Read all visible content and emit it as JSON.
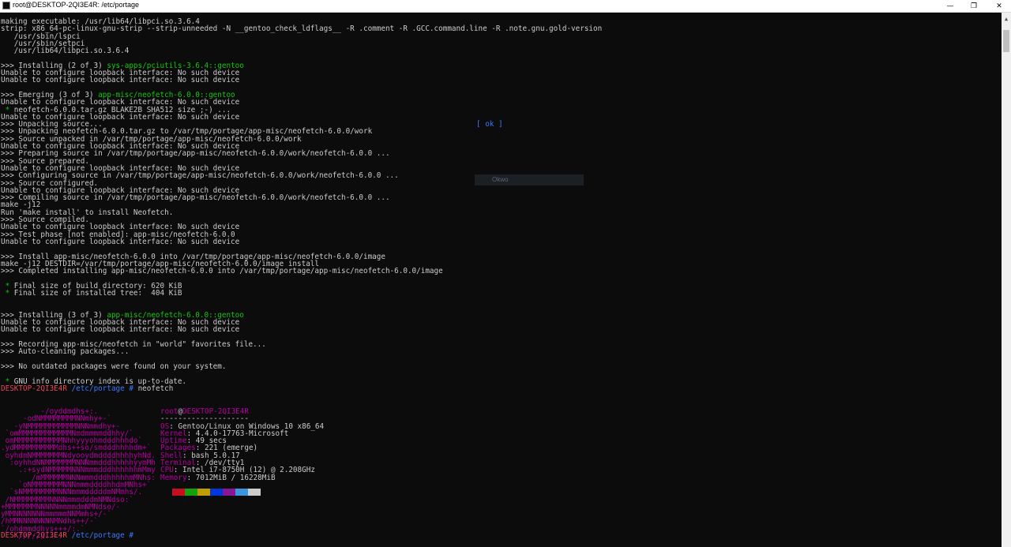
{
  "window": {
    "title": "root@DESKTOP-2QI3E4R: /etc/portage"
  },
  "controls": {
    "minimize": "—",
    "maximize": "❐",
    "close": "✕"
  },
  "build_log": [
    "making executable: /usr/lib64/libpci.so.3.6.4",
    "strip: x86_64-pc-linux-gnu-strip --strip-unneeded -N __gentoo_check_ldflags__ -R .comment -R .GCC.command.line -R .note.gnu.gold-version",
    "   /usr/sbin/lspci",
    "   /usr/sbin/setpci",
    "   /usr/lib64/libpci.so.3.6.4",
    "",
    ">>> Installing (2 of 3) |sys-apps/pciutils-3.6.4::gentoo",
    "Unable to configure loopback interface: No such device",
    "Unable to configure loopback interface: No such device",
    "",
    ">>> Emerging (3 of 3) |app-misc/neofetch-6.0.0::gentoo",
    "Unable to configure loopback interface: No such device",
    " * neofetch-6.0.0.tar.gz BLAKE2B SHA512 size ;-) ...",
    "Unable to configure loopback interface: No such device",
    ">>> Unpacking source...",
    ">>> Unpacking neofetch-6.0.0.tar.gz to /var/tmp/portage/app-misc/neofetch-6.0.0/work",
    ">>> Source unpacked in /var/tmp/portage/app-misc/neofetch-6.0.0/work",
    "Unable to configure loopback interface: No such device",
    ">>> Preparing source in /var/tmp/portage/app-misc/neofetch-6.0.0/work/neofetch-6.0.0 ...",
    ">>> Source prepared.",
    "Unable to configure loopback interface: No such device",
    ">>> Configuring source in /var/tmp/portage/app-misc/neofetch-6.0.0/work/neofetch-6.0.0 ...",
    ">>> Source configured.",
    "Unable to configure loopback interface: No such device",
    ">>> Compiling source in /var/tmp/portage/app-misc/neofetch-6.0.0/work/neofetch-6.0.0 ...",
    "make -j12",
    "Run 'make install' to install Neofetch.",
    ">>> Source compiled.",
    "Unable to configure loopback interface: No such device",
    ">>> Test phase [not enabled]: app-misc/neofetch-6.0.0",
    "Unable to configure loopback interface: No such device",
    "",
    ">>> Install app-misc/neofetch-6.0.0 into /var/tmp/portage/app-misc/neofetch-6.0.0/image",
    "make -j12 DESTDIR=/var/tmp/portage/app-misc/neofetch-6.0.0/image install",
    ">>> Completed installing app-misc/neofetch-6.0.0 into /var/tmp/portage/app-misc/neofetch-6.0.0/image",
    "",
    " * Final size of build directory: 620 KiB",
    " * Final size of installed tree:  404 KiB",
    "",
    "",
    ">>> Installing (3 of 3) |app-misc/neofetch-6.0.0::gentoo",
    "Unable to configure loopback interface: No such device",
    "Unable to configure loopback interface: No such device",
    "",
    ">>> Recording app-misc/neofetch in \"world\" favorites file...",
    ">>> Auto-cleaning packages...",
    "",
    ">>> No outdated packages were found on your system.",
    "",
    " * GNU info directory index is up-to-date."
  ],
  "status": {
    "ok": "[ ok ]",
    "overlay": "Okwo"
  },
  "prompt": {
    "host": "DESKTOP-2QI3E4R",
    "path": "/etc/portage",
    "symbol": "#",
    "command": "neofetch"
  },
  "neofetch": {
    "logo": [
      "         -/oyddmdhs+:.",
      "     -odNMMMMMMMMNNmhy+-`",
      "   -yNMMMMMMMMMMMNNNmmdhy+-",
      " `omMMMMMMMMMMMMNmdmmmmddhhy/`",
      " omMMMMMMMMMMMNhhyyyohmdddhhhdo`",
      ".ydMMMMMMMMMMdhs++so/smdddhhhhdm+`",
      " oyhdmNMMMMMMMNdyooydmddddhhhhyhNd.",
      "  :oyhhdNNMMMMMMMNNNmmdddhhhhhyymMh",
      "    .:+sydNMMMMMNNNmmmdddhhhhhhmMmy",
      "       /mMMMMMMNNNmmmdddhhhhhmMNhs:",
      "    `oNMMMMMMMNNNmmmddddhhdmMNhs+`",
      "  `sNMMMMMMMMNNNmmmdddddmNMmhs/.",
      " /NMMMMMMMMNNNNmmmdddmNMNdso:`",
      "+MMMMMMMNNNNNmmmmdmNMNdso/-",
      "yMMNNNNNNNmmmmmNNMmhs+/-`",
      "/hMMNNNNNNNNMNdhs++/-`",
      "`/ohdmmddhys+++/:.`",
      "  `-//////:--."
    ],
    "user": "root",
    "at": "@",
    "host": "DESKTOP-2QI3E4R",
    "separator": "--------------------",
    "fields": [
      {
        "key": "OS",
        "value": "Gentoo/Linux on Windows 10 x86_64"
      },
      {
        "key": "Kernel",
        "value": "4.4.0-17763-Microsoft"
      },
      {
        "key": "Uptime",
        "value": "49 secs"
      },
      {
        "key": "Packages",
        "value": "221 (emerge)"
      },
      {
        "key": "Shell",
        "value": "bash 5.0.17"
      },
      {
        "key": "Terminal",
        "value": "/dev/tty1"
      },
      {
        "key": "CPU",
        "value": "Intel i7-8750H (12) @ 2.208GHz"
      },
      {
        "key": "Memory",
        "value": "7012MiB / 16228MiB"
      }
    ],
    "palette": [
      "#c50f1f",
      "#13a10e",
      "#c19c00",
      "#0037da",
      "#881798",
      "#3a96dd",
      "#cccccc"
    ]
  }
}
